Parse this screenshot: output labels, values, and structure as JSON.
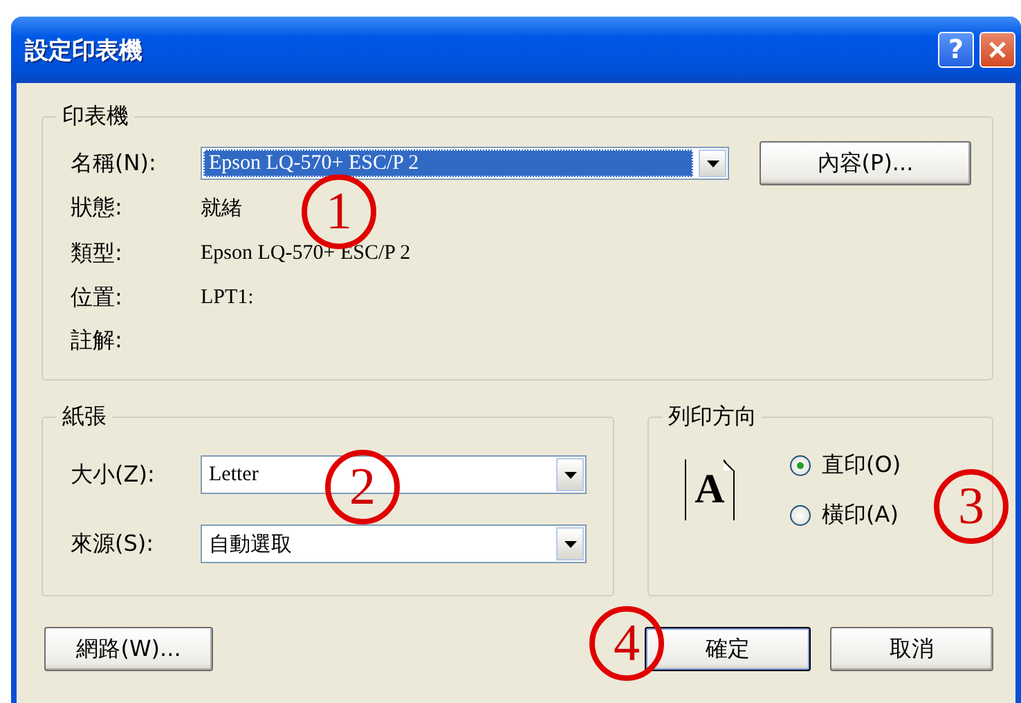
{
  "window": {
    "title": "設定印表機",
    "help_button": "?"
  },
  "printer": {
    "label": "印表機",
    "name_label": "名稱(N):",
    "name_value": "Epson LQ-570+ ESC/P 2",
    "properties_button": "內容(P)...",
    "info": [
      {
        "label": "狀態:",
        "value": "就緒"
      },
      {
        "label": "類型:",
        "value": "Epson LQ-570+ ESC/P 2"
      },
      {
        "label": "位置:",
        "value": "LPT1:"
      },
      {
        "label": "註解:"
      }
    ]
  },
  "paper": {
    "label": "紙張",
    "fields": [
      {
        "label": "大小(Z):",
        "value": "Letter"
      },
      {
        "label": "來源(S):",
        "value": "自動選取"
      }
    ]
  },
  "orientation": {
    "label": "列印方向",
    "icon_letter": "A",
    "options": [
      {
        "label": "直印(O)",
        "selected": true
      },
      {
        "label": "橫印(A)",
        "selected": false
      }
    ]
  },
  "buttons": [
    {
      "label": "網路(W)...",
      "default": false
    },
    {
      "label": "確定",
      "default": true
    },
    {
      "label": "取消",
      "default": false
    }
  ],
  "annotations": [
    {
      "number": "1"
    },
    {
      "number": "2"
    },
    {
      "number": "3"
    },
    {
      "number": "4"
    }
  ]
}
